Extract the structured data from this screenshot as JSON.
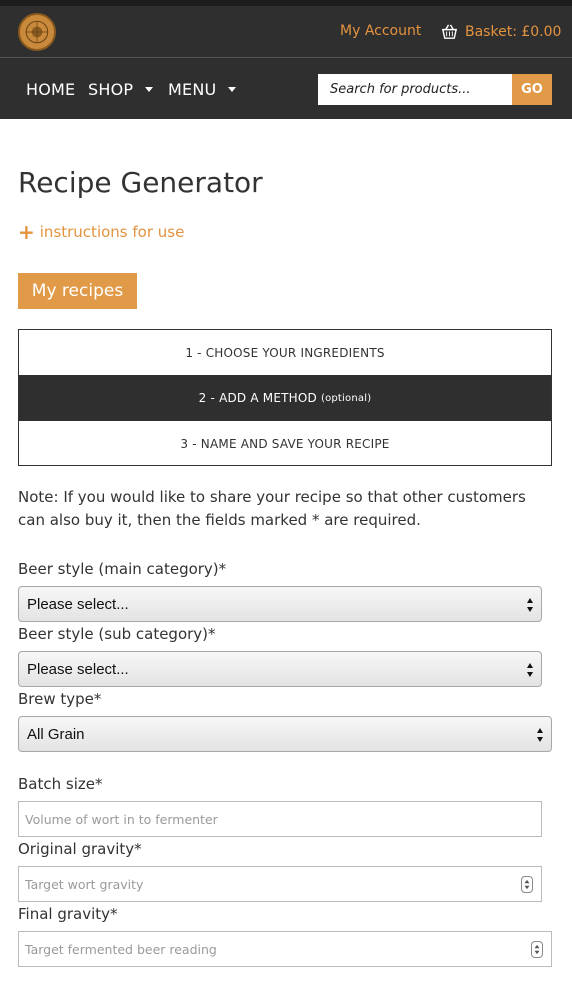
{
  "header": {
    "logo_text": "THE MALT MILLER",
    "account_link": "My Account",
    "basket_label": "Basket: £0.00"
  },
  "nav": {
    "items": [
      {
        "label": "HOME"
      },
      {
        "label": "SHOP"
      },
      {
        "label": "MENU"
      }
    ],
    "search_placeholder": "Search for products...",
    "search_button": "GO"
  },
  "page": {
    "title": "Recipe Generator",
    "instructions_link": "instructions for use",
    "my_recipes_button": "My recipes"
  },
  "steps": [
    {
      "label": "1 - CHOOSE YOUR INGREDIENTS",
      "suffix": ""
    },
    {
      "label": "2 - ADD A METHOD",
      "suffix": "(optional)"
    },
    {
      "label": "3 - NAME AND SAVE YOUR RECIPE",
      "suffix": ""
    }
  ],
  "note": "Note: If you would like to share your recipe so that other customers can also buy it, then the fields marked * are required.",
  "form": {
    "beer_style_main": {
      "label": "Beer style (main category)*",
      "value": "Please select..."
    },
    "beer_style_sub": {
      "label": "Beer style (sub category)*",
      "value": "Please select..."
    },
    "brew_type": {
      "label": "Brew type*",
      "value": "All Grain"
    },
    "batch_size": {
      "label": "Batch size*",
      "placeholder": "Volume of wort in to fermenter"
    },
    "original_gravity": {
      "label": "Original gravity*",
      "placeholder": "Target wort gravity"
    },
    "final_gravity": {
      "label": "Final gravity*",
      "placeholder": "Target fermented beer reading"
    }
  },
  "colors": {
    "accent": "#e19a48",
    "link": "#e4933f",
    "header_bg": "#2f2f2f"
  }
}
